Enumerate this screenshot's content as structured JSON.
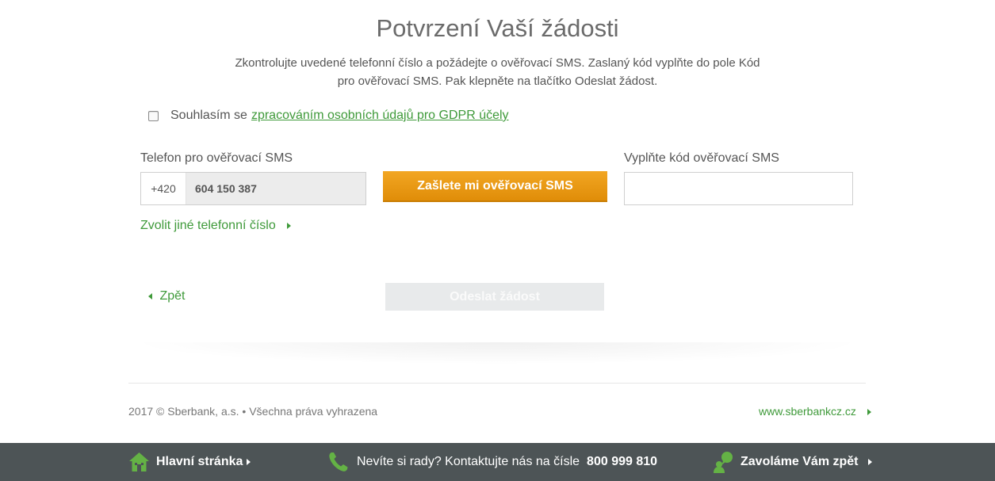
{
  "page": {
    "title": "Potvrzení Vaší žádosti",
    "intro_line1": "Zkontrolujte uvedené telefonní číslo a požádejte o ověřovací SMS. Zaslaný kód vyplňte do pole Kód",
    "intro_line2": "pro ověřovací SMS. Pak klepněte na tlačítko Odeslat žádost."
  },
  "consent": {
    "text": "Souhlasím se",
    "link": "zpracováním osobních údajů pro GDPR účely"
  },
  "form": {
    "phone_label": "Telefon pro ověřovací SMS",
    "phone_prefix": "+420",
    "phone_number": "604 150 387",
    "send_sms_button": "Zašlete mi ověřovací SMS",
    "code_label": "Vyplňte kód ověřovací SMS",
    "code_value": "",
    "other_phone_link": "Zvolit jiné telefonní číslo",
    "back_link": "Zpět",
    "submit_button": "Odeslat žádost"
  },
  "footer": {
    "copyright": "2017 © Sberbank, a.s. • Všechna práva vyhrazena",
    "site_link": "www.sberbankcz.cz",
    "home": "Hlavní stránka",
    "contact_text": "Nevíte si rady? Kontaktujte nás na čísle",
    "contact_number": "800 999 810",
    "callback": "Zavoláme Vám zpět"
  },
  "colors": {
    "accent_green": "#3f9a3a",
    "button_orange": "#e8960f",
    "footer_bg": "#4d5456"
  },
  "icons": [
    "house-icon",
    "phone-icon",
    "callback-icon"
  ]
}
